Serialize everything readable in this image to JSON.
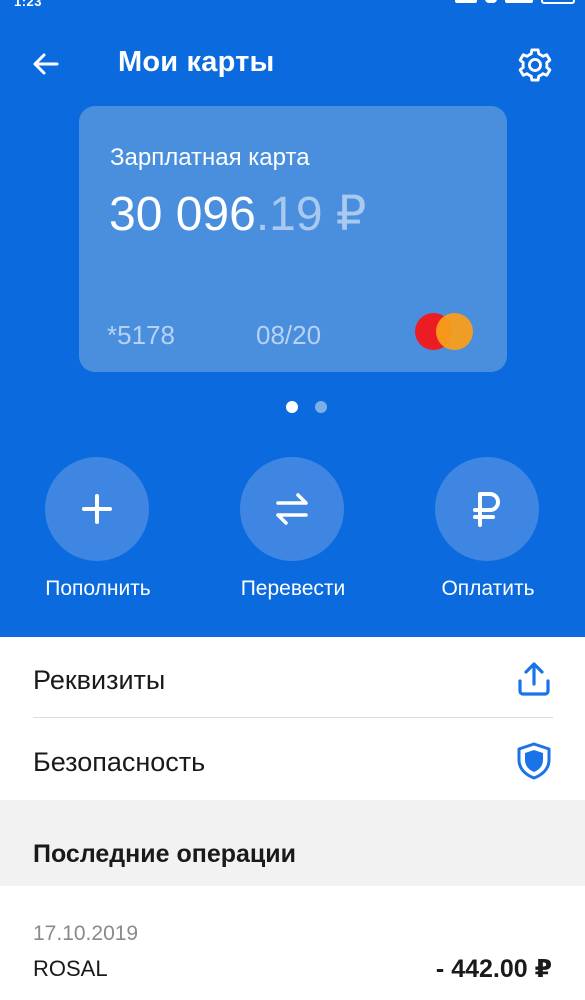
{
  "status_bar": {
    "time": "1:23"
  },
  "header": {
    "title": "Мои карты",
    "back_icon": "arrow-left-icon",
    "settings_icon": "gear-icon"
  },
  "card": {
    "name": "Зарплатная карта",
    "balance_main": "30 096",
    "balance_fraction": ".19 ₽",
    "masked_number": "*5178",
    "expiry": "08/20",
    "network_icon": "mastercard-logo"
  },
  "pager": {
    "pages": 2,
    "active": 1
  },
  "actions": [
    {
      "label": "Пополнить",
      "icon": "plus-icon"
    },
    {
      "label": "Перевести",
      "icon": "transfer-arrows-icon"
    },
    {
      "label": "Оплатить",
      "icon": "ruble-icon"
    }
  ],
  "menu": [
    {
      "label": "Реквизиты",
      "icon": "share-upload-icon"
    },
    {
      "label": "Безопасность",
      "icon": "shield-icon"
    }
  ],
  "operations": {
    "title": "Последние операции",
    "items": [
      {
        "date": "17.10.2019",
        "merchant": "ROSAL",
        "amount": "- 442.00 ₽"
      }
    ]
  },
  "colors": {
    "primary_blue": "#0b6bde",
    "card_blue": "#4a8fdd",
    "action_circle": "#3f86e2",
    "accent_icon": "#1a73e8"
  }
}
